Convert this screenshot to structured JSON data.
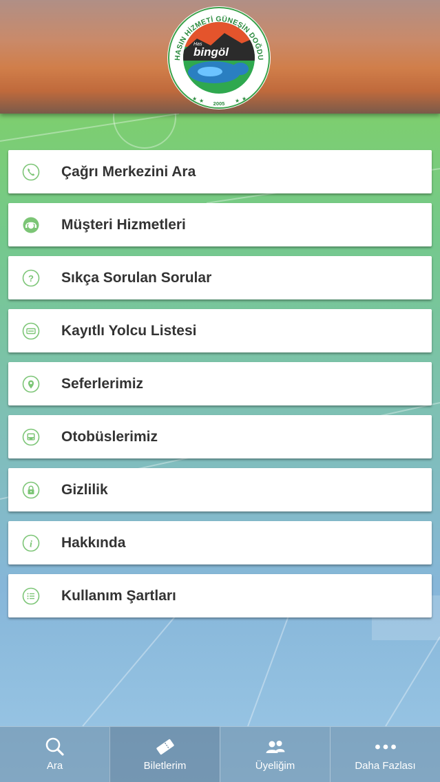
{
  "header": {
    "logo_icon": "bingol-seal-logo",
    "logo_text": {
      "ring": "HASIN HİZMETİ GÜNEŞİN DOĞDUĞU YERDEDİR",
      "small": "Has",
      "brand": "bingöl",
      "year": "2005"
    }
  },
  "menu": {
    "accent_color": "#7cc576",
    "items": [
      {
        "label": "Çağrı Merkezini Ara",
        "icon": "phone-icon"
      },
      {
        "label": "Müşteri Hizmetleri",
        "icon": "support-agent-icon"
      },
      {
        "label": "Sıkça Sorulan Sorular",
        "icon": "question-icon"
      },
      {
        "label": "Kayıtlı Yolcu Listesi",
        "icon": "card-icon"
      },
      {
        "label": "Seferlerimiz",
        "icon": "map-pin-icon"
      },
      {
        "label": "Otobüslerimiz",
        "icon": "bus-icon"
      },
      {
        "label": "Gizlilik",
        "icon": "lock-icon"
      },
      {
        "label": "Hakkında",
        "icon": "info-icon"
      },
      {
        "label": "Kullanım Şartları",
        "icon": "list-icon"
      }
    ]
  },
  "tabbar": {
    "tabs": [
      {
        "label": "Ara",
        "icon": "search-icon"
      },
      {
        "label": "Biletlerim",
        "icon": "ticket-icon"
      },
      {
        "label": "Üyeliğim",
        "icon": "users-icon"
      },
      {
        "label": "Daha Fazlası",
        "icon": "more-dots-icon"
      }
    ]
  }
}
